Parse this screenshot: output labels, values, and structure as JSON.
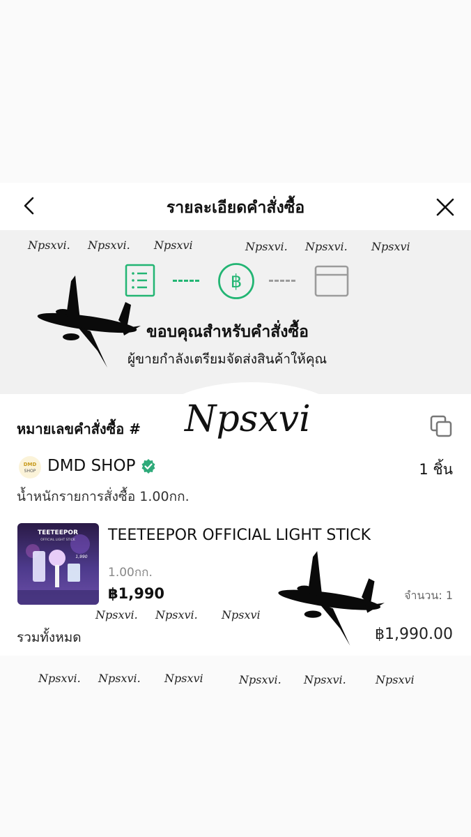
{
  "header": {
    "title": "รายละเอียดคำสั่งซื้อ"
  },
  "watermark": {
    "short": "Npsxvi.",
    "alt": "Npsxvi",
    "big": "Npsxvi"
  },
  "status": {
    "thanks": "ขอบคุณสำหรับคำสั่งซื้อ",
    "subtitle": "ผู้ขายกำลังเตรียมจัดส่งสินค้าให้คุณ",
    "active_color": "#22b573",
    "inactive_color": "#9b9b9b"
  },
  "order": {
    "number_label": "หมายเลขคำสั่งซื้อ #",
    "shop_logo_text": "DMD SHOP",
    "shop_name": "DMD SHOP",
    "item_count": "1 ชิ้น",
    "weight": "น้ำหนักรายการสั่งซื้อ 1.00กก.",
    "product": {
      "name": "TEETEEPOR OFFICIAL LIGHT STICK",
      "thumb_title": "TEETEEPOR",
      "thumb_subtitle": "OFFICIAL LIGHT STICK",
      "thumb_price": "1,990",
      "weight": "1.00กก.",
      "price": "฿1,990",
      "quantity": "จำนวน: 1"
    },
    "total_label": "รวมทั้งหมด",
    "total_value": "฿1,990.00"
  }
}
